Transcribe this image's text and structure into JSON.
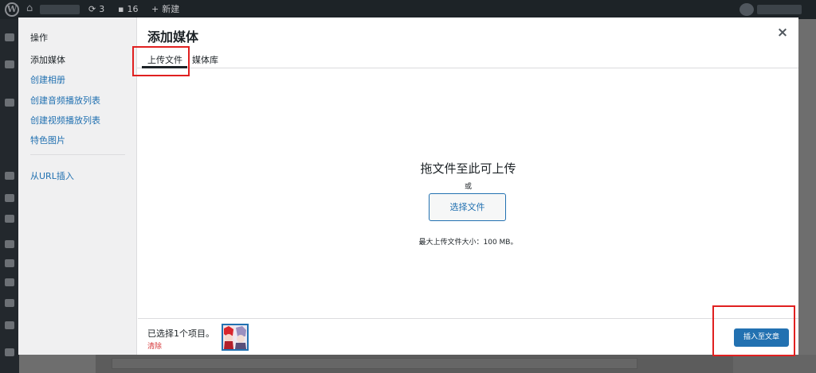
{
  "adminbar": {
    "wp_logo_glyph": "W",
    "updates_count": "3",
    "comments_count": "16",
    "new_label": "新建"
  },
  "modal": {
    "title": "添加媒体",
    "close_glyph": "×"
  },
  "menu": {
    "heading": "操作",
    "items": [
      {
        "label": "添加媒体",
        "active": true
      },
      {
        "label": "创建相册"
      },
      {
        "label": "创建音频播放列表"
      },
      {
        "label": "创建视频播放列表"
      },
      {
        "label": "特色图片"
      }
    ],
    "url_insert": "从URL插入"
  },
  "tabs": [
    {
      "label": "上传文件",
      "active": true
    },
    {
      "label": "媒体库"
    }
  ],
  "upload": {
    "drop_title": "拖文件至此可上传",
    "or": "或",
    "select_button": "选择文件",
    "max_size": "最大上传文件大小：100 MB。"
  },
  "selection": {
    "count_text": "已选择1个项目。",
    "clear": "清除"
  },
  "toolbar": {
    "insert_button": "插入至文章"
  },
  "colors": {
    "accent": "#2271b1",
    "danger": "#d63638",
    "highlight": "#e02020"
  }
}
